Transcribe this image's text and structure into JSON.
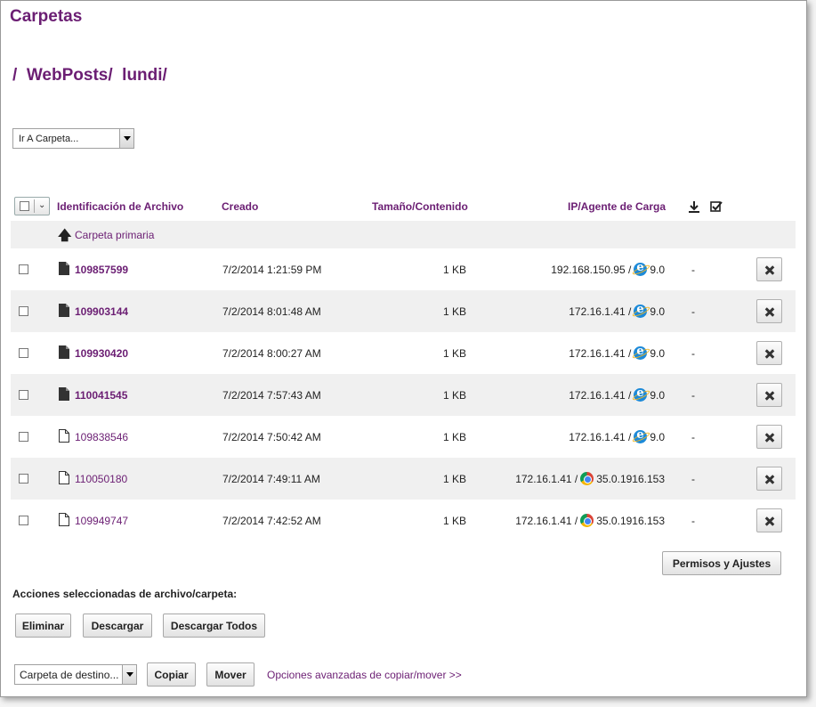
{
  "title": "Carpetas",
  "breadcrumb": "/  WebPosts/  lundi/",
  "goto_folder": {
    "value": "Ir A Carpeta..."
  },
  "table": {
    "headers": {
      "file_id": "Identificación de Archivo",
      "created": "Creado",
      "size": "Tamaño/Contenido",
      "ip_agent": "IP/Agente de Carga"
    },
    "parent_folder": "Carpeta primaria",
    "rows": [
      {
        "id": "109857599",
        "created": "7/2/2014 1:21:59 PM",
        "size": "1 KB",
        "ip": "192.168.150.95 /",
        "browser": "ie",
        "version": "9.0",
        "dash": "-",
        "bold": true
      },
      {
        "id": "109903144",
        "created": "7/2/2014 8:01:48 AM",
        "size": "1 KB",
        "ip": "172.16.1.41 /",
        "browser": "ie",
        "version": "9.0",
        "dash": "-",
        "bold": true
      },
      {
        "id": "109930420",
        "created": "7/2/2014 8:00:27 AM",
        "size": "1 KB",
        "ip": "172.16.1.41 /",
        "browser": "ie",
        "version": "9.0",
        "dash": "-",
        "bold": true
      },
      {
        "id": "110041545",
        "created": "7/2/2014 7:57:43 AM",
        "size": "1 KB",
        "ip": "172.16.1.41 /",
        "browser": "ie",
        "version": "9.0",
        "dash": "-",
        "bold": true
      },
      {
        "id": "109838546",
        "created": "7/2/2014 7:50:42 AM",
        "size": "1 KB",
        "ip": "172.16.1.41 /",
        "browser": "ie",
        "version": "9.0",
        "dash": "-",
        "bold": false
      },
      {
        "id": "110050180",
        "created": "7/2/2014 7:49:11 AM",
        "size": "1 KB",
        "ip": "172.16.1.41 /",
        "browser": "chrome",
        "version": "35.0.1916.153",
        "dash": "-",
        "bold": false
      },
      {
        "id": "109949747",
        "created": "7/2/2014 7:42:52 AM",
        "size": "1 KB",
        "ip": "172.16.1.41 /",
        "browser": "chrome",
        "version": "35.0.1916.153",
        "dash": "-",
        "bold": false
      }
    ]
  },
  "buttons": {
    "permissions": "Permisos y Ajustes",
    "delete": "Eliminar",
    "download": "Descargar",
    "download_all": "Descargar Todos",
    "copy": "Copiar",
    "move": "Mover"
  },
  "actions_title": "Acciones seleccionadas de archivo/carpeta:",
  "destination_folder": {
    "value": "Carpeta de destino..."
  },
  "advanced_link": "Opciones avanzadas de copiar/mover >>",
  "colors": {
    "accent": "#6b1e73",
    "row_alt": "#f0f0f0"
  }
}
